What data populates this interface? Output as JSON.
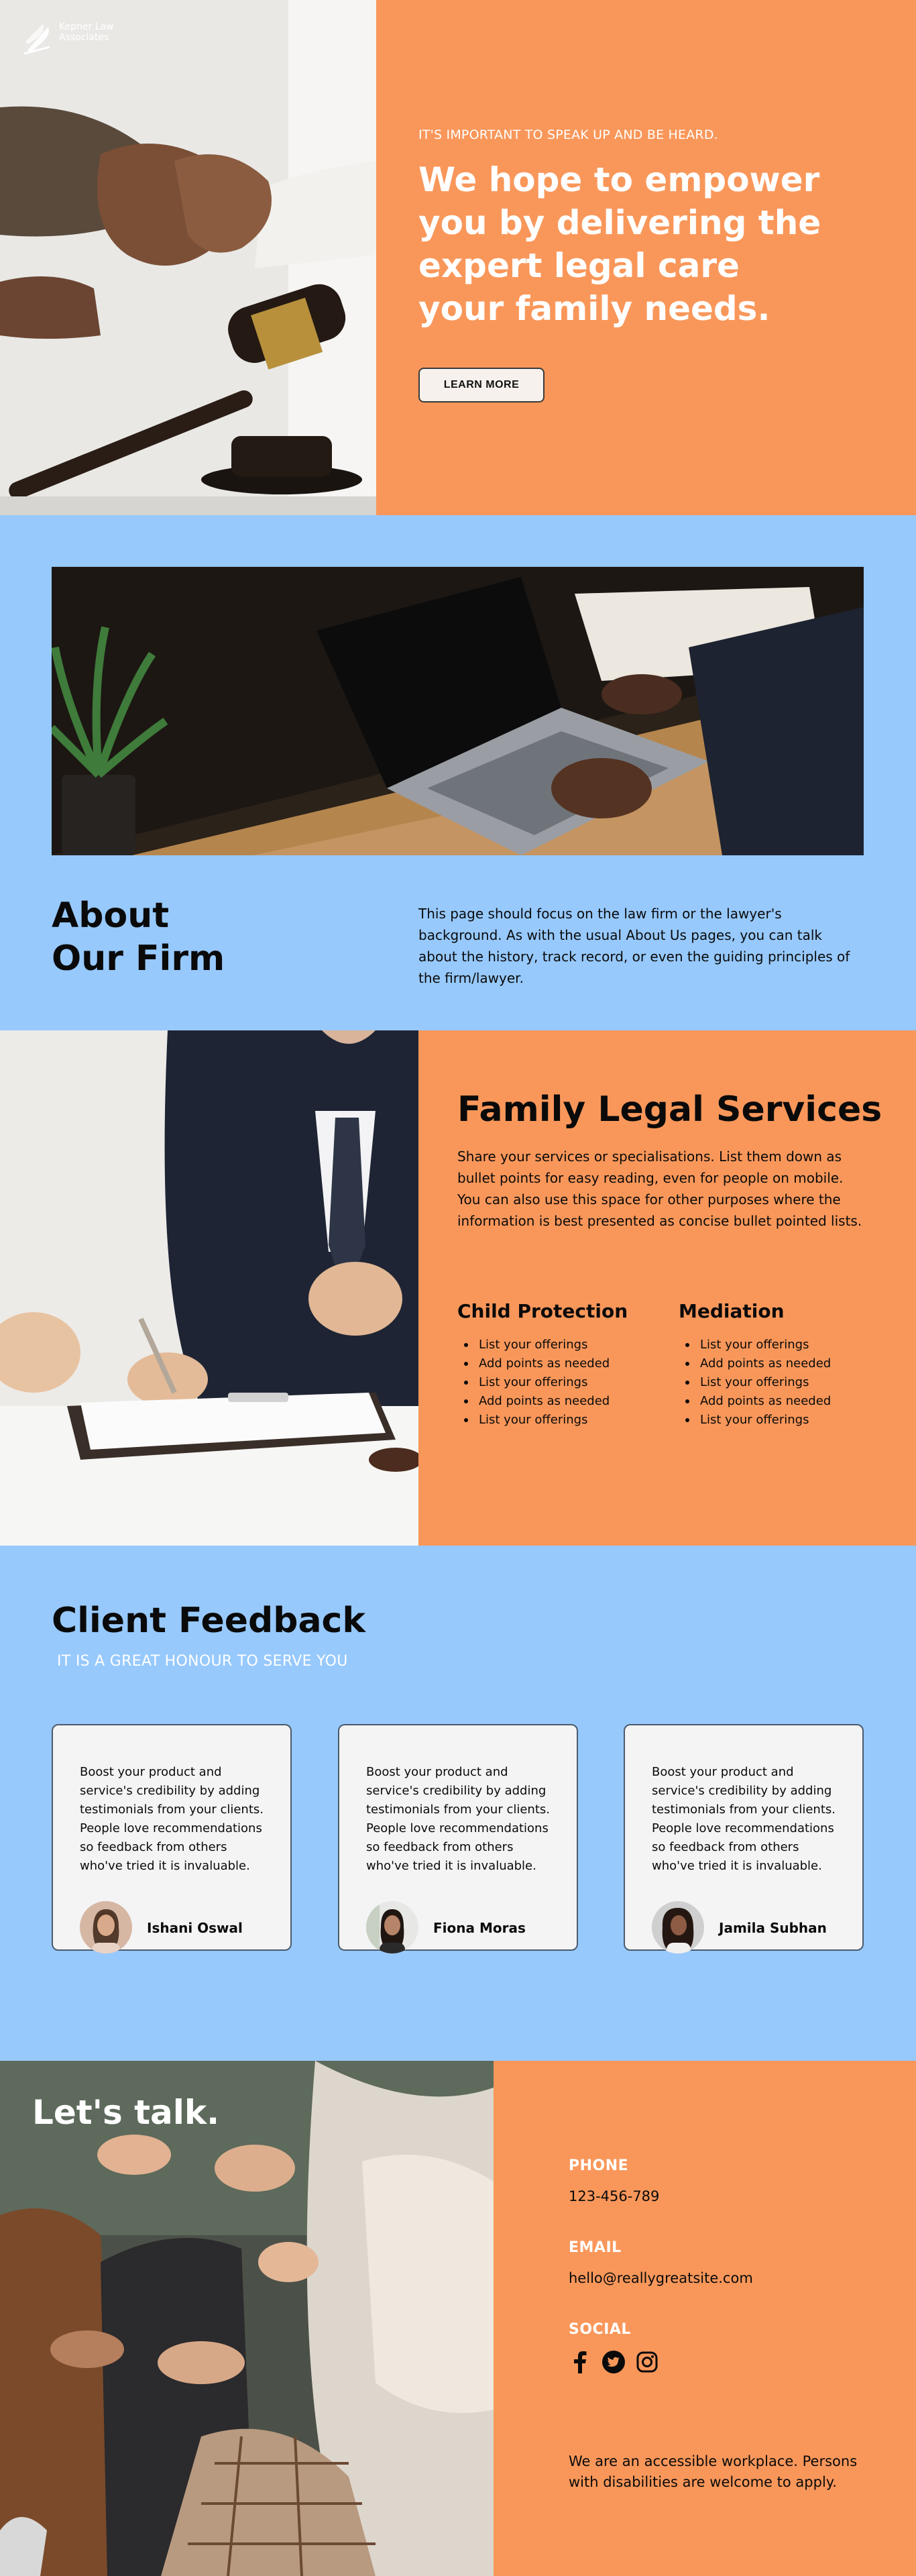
{
  "colors": {
    "accent_orange": "#f9975a",
    "accent_blue": "#97c9fd",
    "text_dark": "#0a0a0a",
    "white": "#ffffff"
  },
  "hero": {
    "logo_text": "Kepner Law Associates",
    "kicker": "IT'S IMPORTANT TO SPEAK UP AND BE HEARD.",
    "headline": "We hope to empower you by delivering the expert legal care your family needs.",
    "cta_label": "LEARN MORE",
    "photo_icon": "handshake-gavel-photo"
  },
  "about": {
    "title_line1": "About",
    "title_line2": "Our Firm",
    "text": "This page should focus on the law firm or the lawyer's background. As with the usual About Us pages, you can talk about the history, track record, or even the guiding principles of the firm/lawyer.",
    "photo_icon": "laptop-meeting-photo"
  },
  "services": {
    "title": "Family Legal Services",
    "intro": "Share your services or specialisations. List them down as bullet points for easy reading, even for people on mobile. You can also use this space for other purposes where the information is best presented as concise bullet pointed lists.",
    "columns": [
      {
        "heading": "Child Protection",
        "items": [
          "List your offerings",
          "Add points as needed",
          "List your offerings",
          "Add points as needed",
          "List your offerings"
        ]
      },
      {
        "heading": "Mediation",
        "items": [
          "List your offerings",
          "Add points as needed",
          "List your offerings",
          "Add points as needed",
          "List your offerings"
        ]
      }
    ],
    "photo_icon": "lawyer-signing-photo"
  },
  "feedback": {
    "title": "Client Feedback",
    "subtitle": "IT IS A GREAT HONOUR TO SERVE YOU",
    "cards": [
      {
        "quote": "Boost your product and service's credibility by adding testimonials from your clients. People love recommendations so feedback from others who've tried it is invaluable.",
        "name": "Ishani Oswal"
      },
      {
        "quote": "Boost your product and service's credibility by adding testimonials from your clients. People love recommendations so feedback from others who've tried it is invaluable.",
        "name": "Fiona Moras"
      },
      {
        "quote": "Boost your product and service's credibility by adding testimonials from your clients. People love recommendations so feedback from others who've tried it is invaluable.",
        "name": "Jamila Subhan"
      }
    ]
  },
  "contact": {
    "heading": "Let's talk.",
    "phone_label": "PHONE",
    "phone_value": "123-456-789",
    "email_label": "EMAIL",
    "email_value": "hello@reallygreatsite.com",
    "social_label": "SOCIAL",
    "social_icons": [
      "facebook-icon",
      "twitter-icon",
      "instagram-icon"
    ],
    "note": "We are an accessible workplace. Persons with disabilities are welcome to apply.",
    "photo_icon": "group-conversation-photo"
  }
}
